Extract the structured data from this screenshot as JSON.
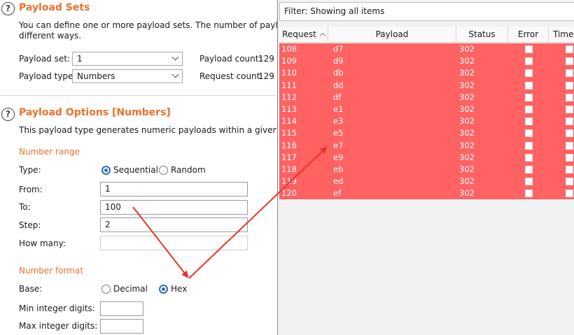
{
  "payload_sets": {
    "title": "Payload Sets",
    "description_line1": "You can define one or more payload sets. The number of payload sets",
    "description_line2": "different ways.",
    "payload_set_label": "Payload set:",
    "payload_set_value": "1",
    "payload_count_label": "Payload count:",
    "payload_count_value": "129",
    "payload_type_label": "Payload type:",
    "payload_type_value": "Numbers",
    "request_count_label": "Request count:",
    "request_count_value": "129"
  },
  "payload_options": {
    "title": "Payload Options [Numbers]",
    "description": "This payload type generates numeric payloads within a given range and",
    "number_range": {
      "heading": "Number range",
      "type_label": "Type:",
      "type_options": [
        "Sequential",
        "Random"
      ],
      "type_selected": "Sequential",
      "from_label": "From:",
      "from_value": "1",
      "to_label": "To:",
      "to_value": "100",
      "step_label": "Step:",
      "step_value": "2",
      "how_many_label": "How many:",
      "how_many_value": ""
    },
    "number_format": {
      "heading": "Number format",
      "base_label": "Base:",
      "base_options": [
        "Decimal",
        "Hex"
      ],
      "base_selected": "Hex",
      "min_digits_label": "Min integer digits:",
      "min_digits_value": "",
      "max_digits_label": "Max integer digits:",
      "max_digits_value": ""
    }
  },
  "results": {
    "filter_text": "Filter: Showing all items",
    "columns": [
      "Request",
      "Payload",
      "Status",
      "Error",
      "Time"
    ],
    "row_color": "#ff6262",
    "rows": [
      {
        "request": "108",
        "payload": "d7",
        "status": "302"
      },
      {
        "request": "109",
        "payload": "d9",
        "status": "302"
      },
      {
        "request": "110",
        "payload": "db",
        "status": "302"
      },
      {
        "request": "111",
        "payload": "dd",
        "status": "302"
      },
      {
        "request": "112",
        "payload": "df",
        "status": "302"
      },
      {
        "request": "113",
        "payload": "e1",
        "status": "302"
      },
      {
        "request": "114",
        "payload": "e3",
        "status": "302"
      },
      {
        "request": "115",
        "payload": "e5",
        "status": "302"
      },
      {
        "request": "116",
        "payload": "e7",
        "status": "302"
      },
      {
        "request": "117",
        "payload": "e9",
        "status": "302"
      },
      {
        "request": "118",
        "payload": "eb",
        "status": "302"
      },
      {
        "request": "119",
        "payload": "ed",
        "status": "302"
      },
      {
        "request": "120",
        "payload": "ef",
        "status": "302"
      }
    ]
  },
  "accent_color": "#e8722c",
  "annotation_color": "#e8332a"
}
